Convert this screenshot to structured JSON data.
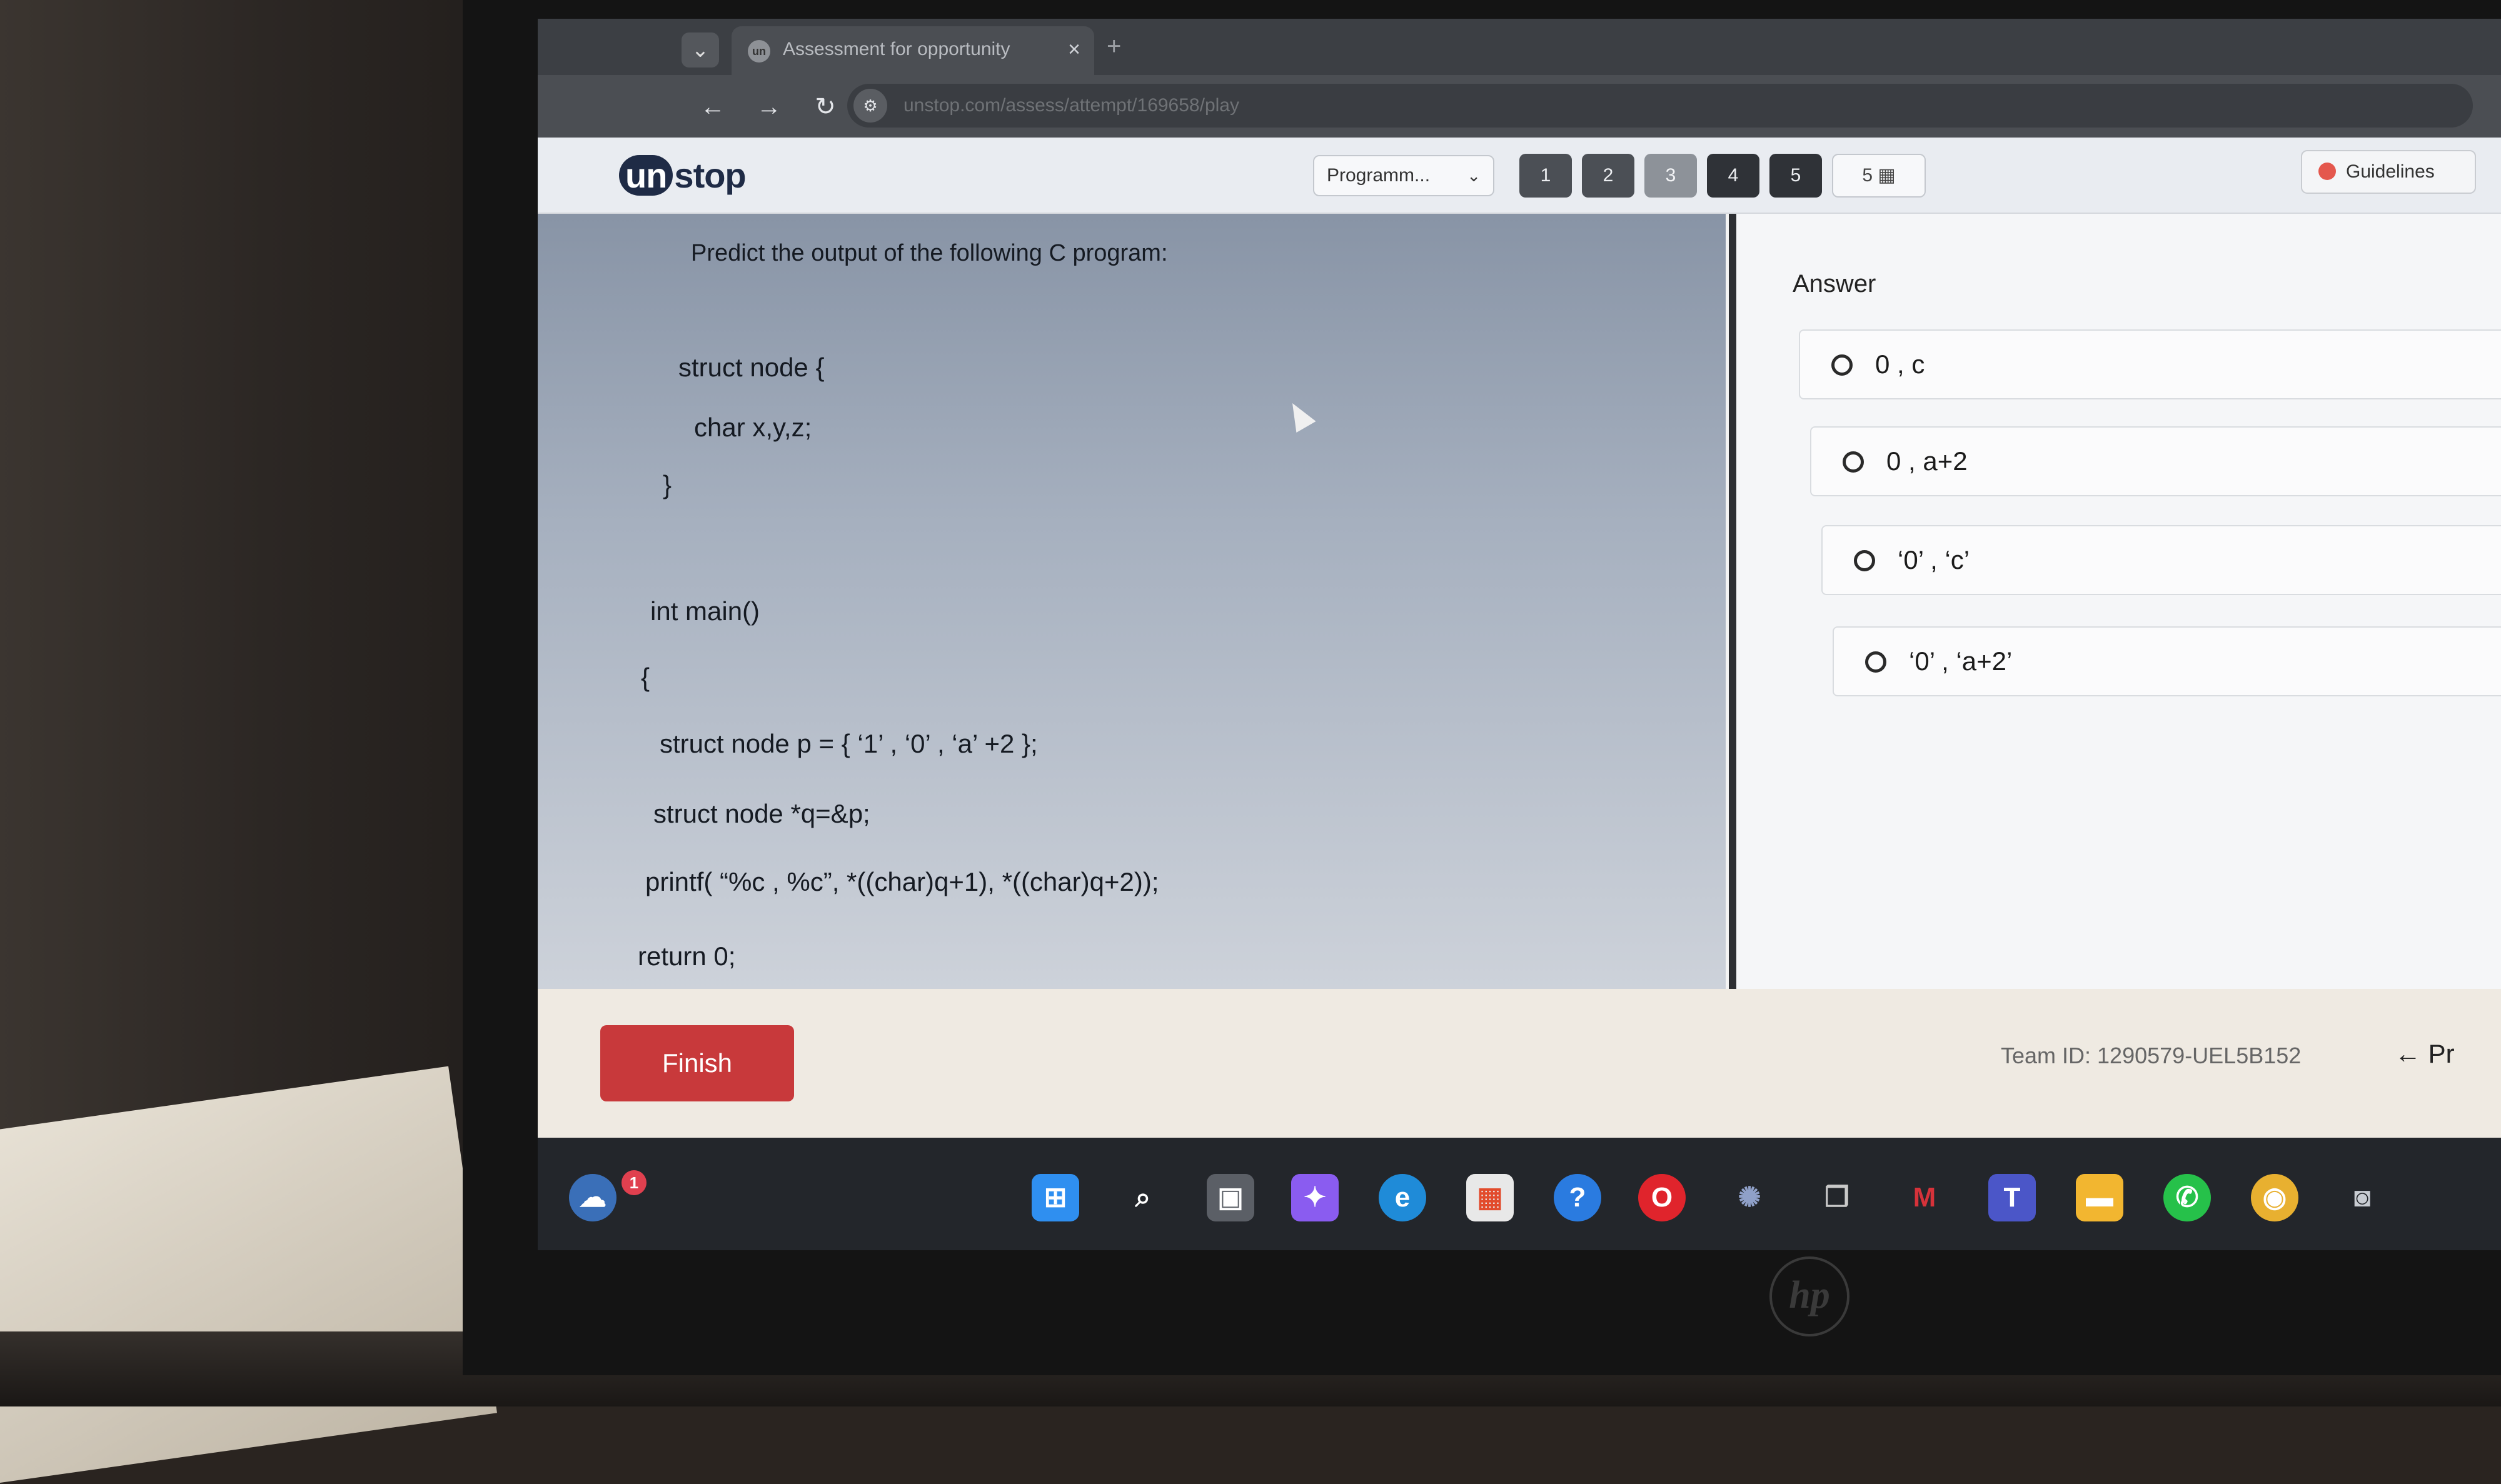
{
  "browser": {
    "tab_title": "Assessment for opportunity",
    "tab_close": "×",
    "new_tab": "+",
    "url": "unstop.com/assess/attempt/169658/play"
  },
  "header": {
    "logo_prefix": "un",
    "logo_suffix": "stop",
    "section_select": "Programm...",
    "question_numbers": [
      "1",
      "2",
      "3",
      "4",
      "5"
    ],
    "grid_button": "5 ▦",
    "guidelines_label": "Guidelines"
  },
  "question": {
    "title": "Predict the output of the following C program:",
    "code_lines": [
      "struct node {",
      "char x,y,z;",
      "}",
      "int main()",
      "{",
      "struct node p = { ‘1’ , ‘0’ , ‘a’ +2 };",
      "struct node *q=&p;",
      "printf( “%c , %c”, *((char)q+1), *((char)q+2));",
      "return 0;"
    ]
  },
  "answer": {
    "heading": "Answer",
    "options": [
      "0 , c",
      "0 , a+2",
      "‘0’ , ‘c’",
      "‘0’ , ‘a+2’"
    ]
  },
  "footer": {
    "finish_label": "Finish",
    "team_id": "Team ID: 1290579-UEL5B152",
    "prev_label": "← Pr"
  },
  "taskbar": {
    "weather_badge": "1",
    "icons": [
      "weather-icon",
      "windows-start-icon",
      "search-icon",
      "task-view-icon",
      "copilot-icon",
      "edge-icon",
      "store-icon",
      "help-icon",
      "opera-icon",
      "app-icon",
      "package-icon",
      "mcafee-icon",
      "teams-icon",
      "file-explorer-icon",
      "whatsapp-icon",
      "chrome-icon",
      "camera-icon"
    ]
  }
}
